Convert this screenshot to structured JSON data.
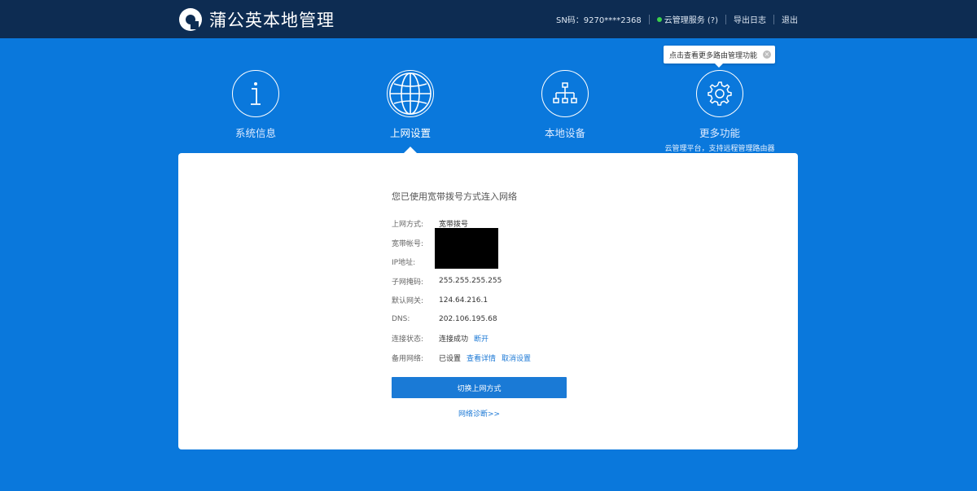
{
  "header": {
    "title": "蒲公英本地管理",
    "sn_text": "SN码：9270****2368",
    "cloud_service": "云管理服务 (?)",
    "export_log": "导出日志",
    "logout": "退出"
  },
  "nav": {
    "items": [
      {
        "label": "系统信息",
        "icon": "info-icon"
      },
      {
        "label": "上网设置",
        "icon": "globe-icon"
      },
      {
        "label": "本地设备",
        "icon": "network-tree-icon"
      },
      {
        "label": "更多功能",
        "icon": "gear-icon",
        "sub": "云管理平台，支持远程管理路由器"
      }
    ],
    "active": "上网设置"
  },
  "tooltip": {
    "text": "点击查看更多路由管理功能"
  },
  "panel": {
    "heading": "您已使用宽带拨号方式连入网络",
    "rows": [
      {
        "label": "上网方式:",
        "value": "宽带拨号"
      },
      {
        "label": "宽带帐号:",
        "value": ""
      },
      {
        "label": "IP地址:",
        "value": ""
      },
      {
        "label": "子网掩码:",
        "value": "255.255.255.255"
      },
      {
        "label": "默认网关:",
        "value": "124.64.216.1"
      },
      {
        "label": "DNS:",
        "value": "202.106.195.68"
      },
      {
        "label": "连接状态:",
        "value": "连接成功",
        "link": "断开"
      },
      {
        "label": "备用网络:",
        "value": "已设置",
        "link": "查看详情",
        "link2": "取消设置"
      }
    ],
    "switch_button": "切换上网方式",
    "diagnose_link": "网络诊断>>"
  },
  "colors": {
    "topbar": "#0d2c52",
    "background": "#0a78dc",
    "accent": "#1a7ad6",
    "status_online": "#3bd14b"
  }
}
